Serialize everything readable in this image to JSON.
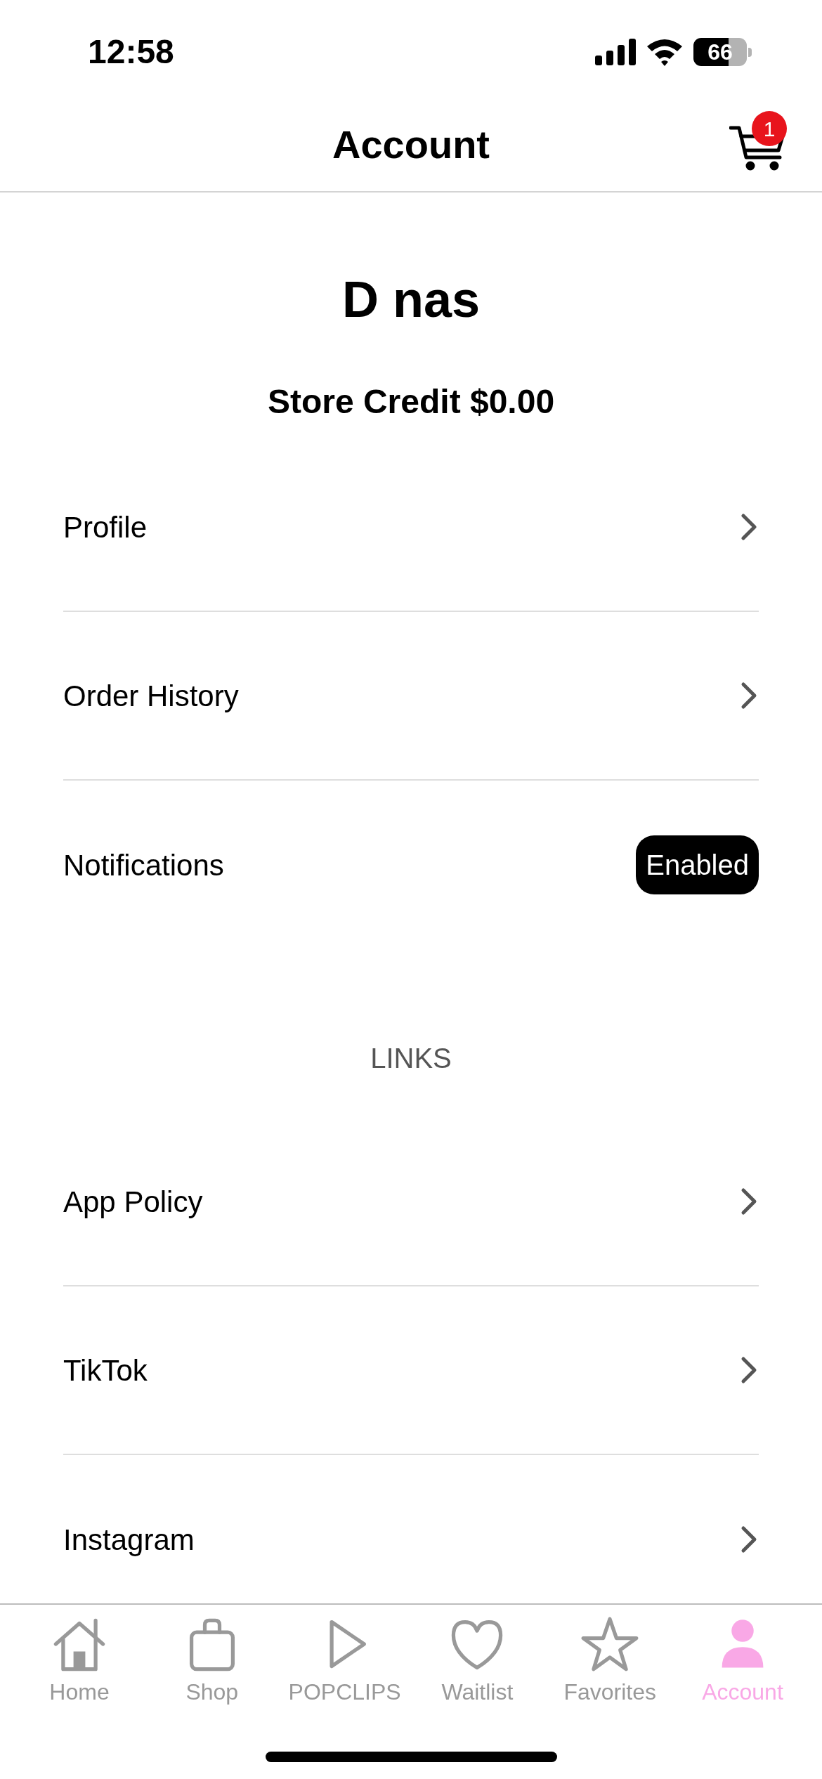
{
  "status_bar": {
    "time": "12:58",
    "battery": "66"
  },
  "header": {
    "title": "Account",
    "cart_count": "1"
  },
  "user": {
    "name": "D nas",
    "store_credit": "Store Credit $0.00"
  },
  "account_rows": [
    {
      "kind": "link",
      "label": "Profile"
    },
    {
      "kind": "link",
      "label": "Order History"
    },
    {
      "kind": "badge",
      "label": "Notifications",
      "badge": "Enabled"
    }
  ],
  "links_heading": "LINKS",
  "link_rows": [
    {
      "kind": "link",
      "label": "App Policy"
    },
    {
      "kind": "link",
      "label": "TikTok"
    },
    {
      "kind": "link",
      "label": "Instagram"
    }
  ],
  "tabs": [
    {
      "label": "Home",
      "selected": false
    },
    {
      "label": "Shop",
      "selected": false
    },
    {
      "label": "POPCLIPS",
      "selected": false
    },
    {
      "label": "Waitlist",
      "selected": false
    },
    {
      "label": "Favorites",
      "selected": false
    },
    {
      "label": "Account",
      "selected": true
    }
  ]
}
